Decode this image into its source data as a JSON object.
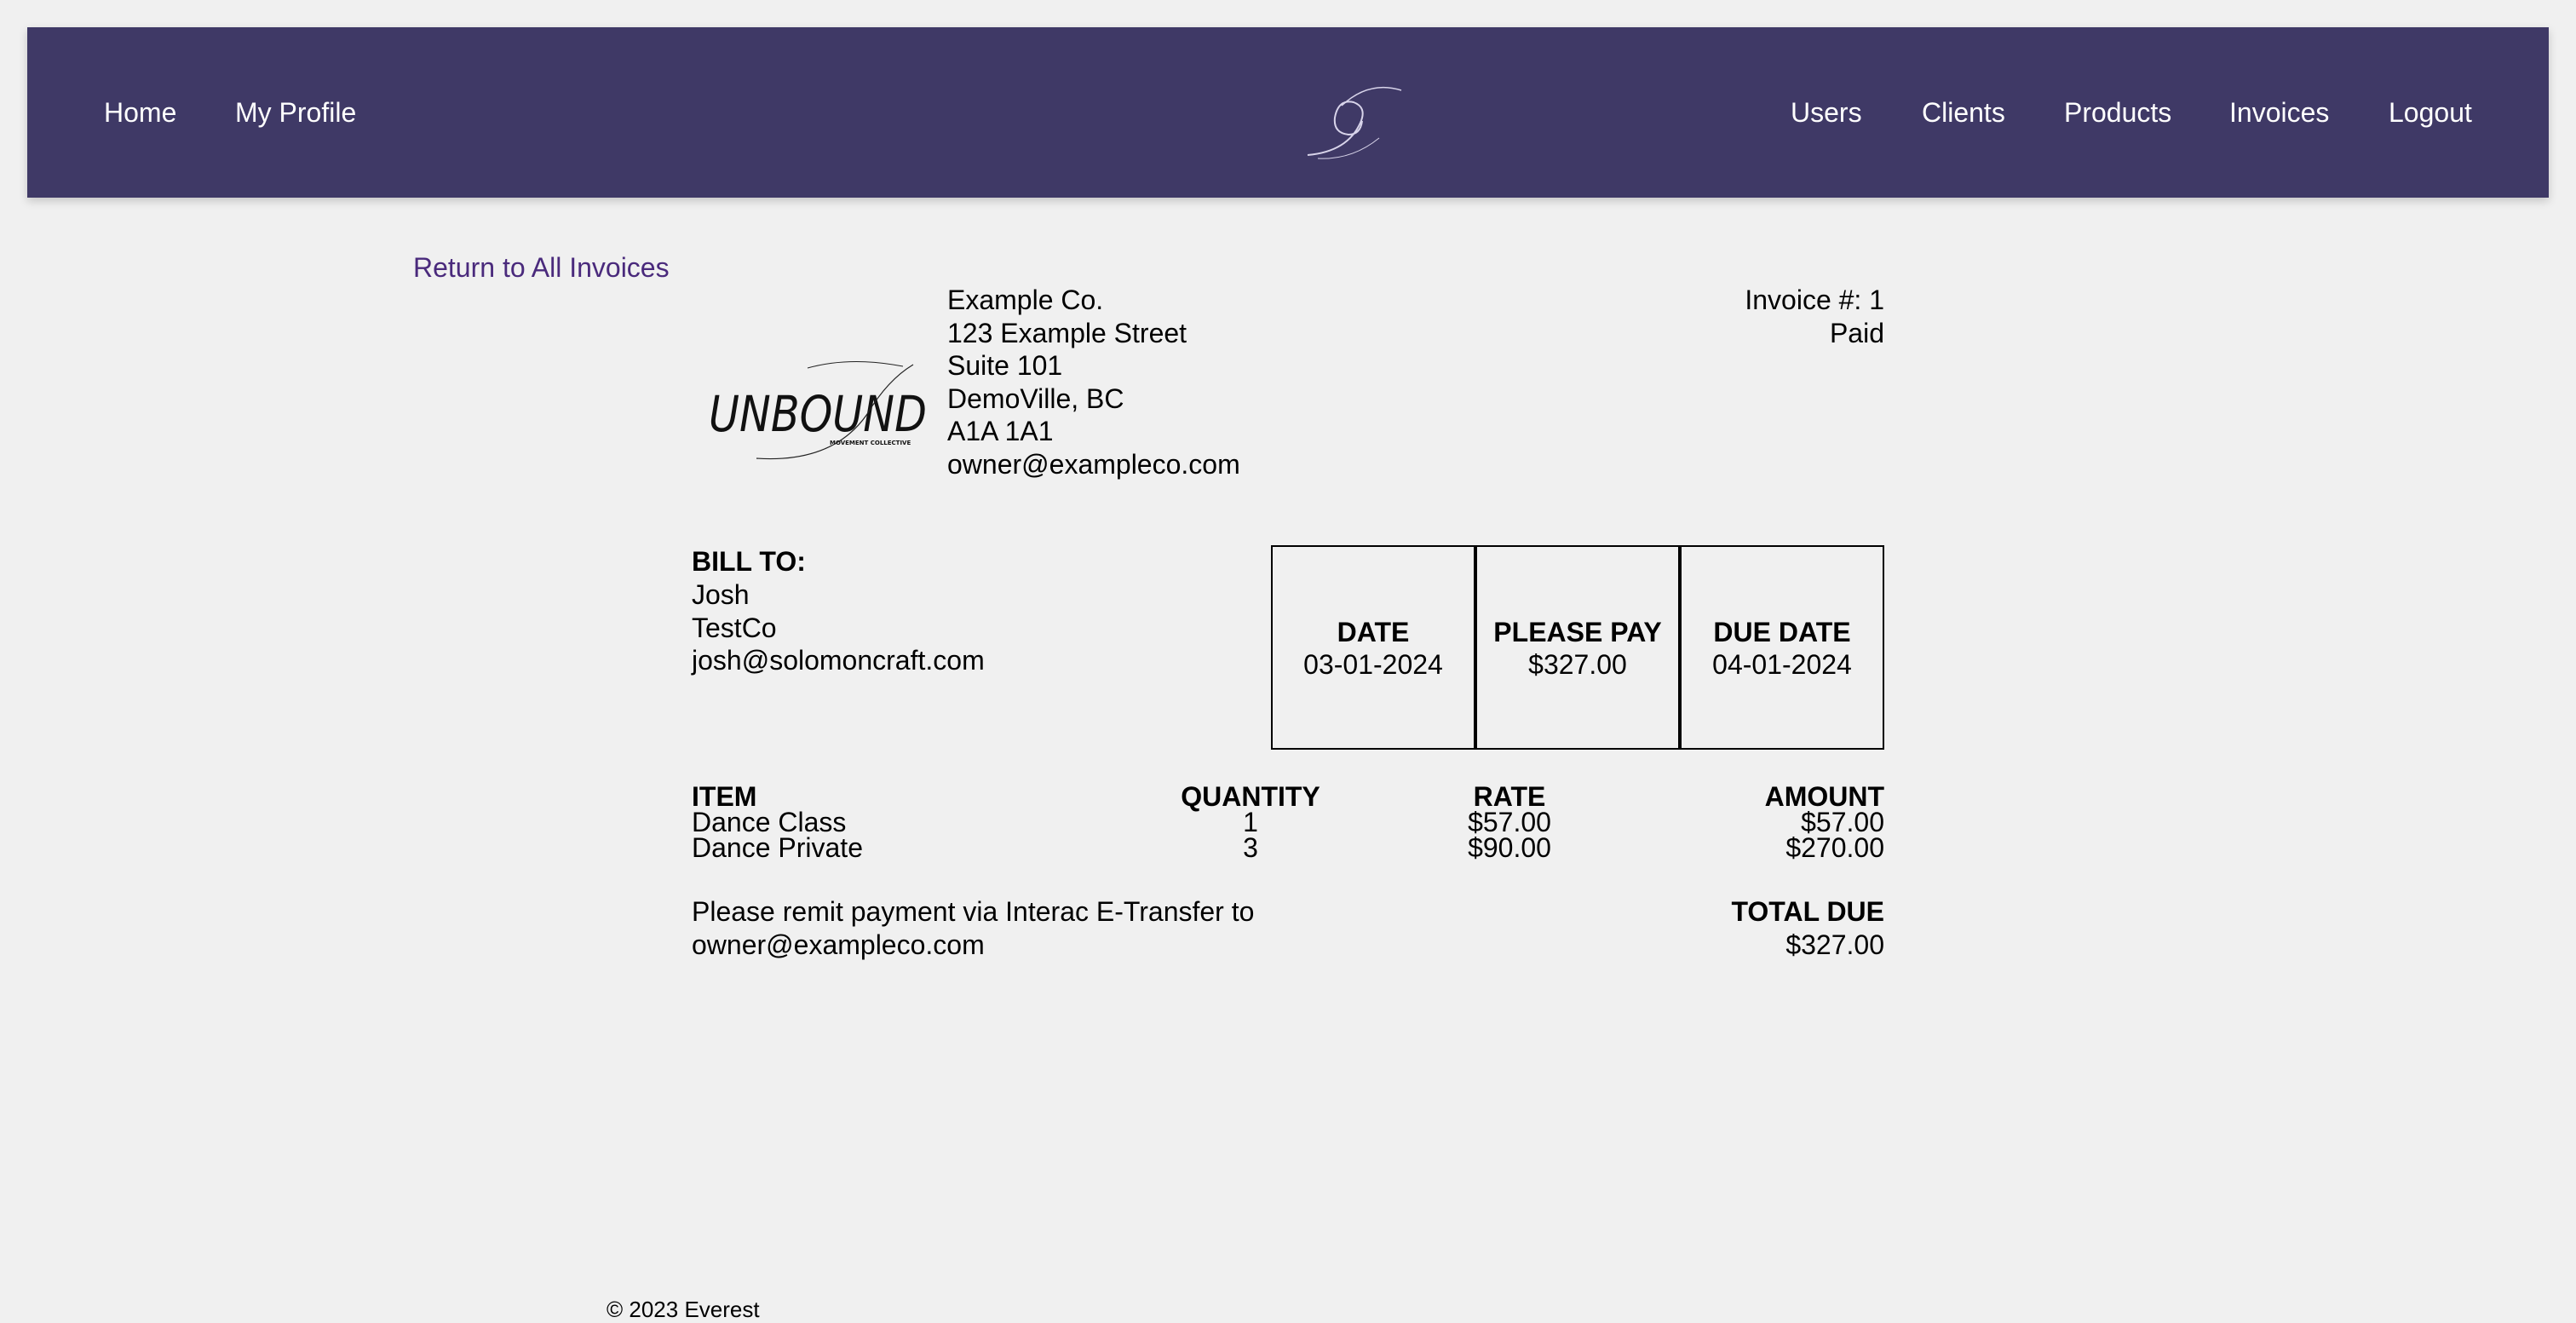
{
  "nav": {
    "home": "Home",
    "my_profile": "My Profile",
    "users": "Users",
    "clients": "Clients",
    "products": "Products",
    "invoices": "Invoices",
    "logout": "Logout"
  },
  "return_link": "Return to All Invoices",
  "company": {
    "logo_text": "UNBOUND",
    "logo_subtext": "MOVEMENT COLLECTIVE",
    "name": "Example Co.",
    "street": "123 Example Street",
    "suite": "Suite 101",
    "city": "DemoVille, BC",
    "postal": "A1A 1A1",
    "email": "owner@exampleco.com"
  },
  "invoice": {
    "number_label": "Invoice #: 1",
    "status": "Paid"
  },
  "bill_to": {
    "heading": "BILL TO:",
    "name": "Josh",
    "company": "TestCo",
    "email": "josh@solomoncraft.com"
  },
  "summary": {
    "date_label": "DATE",
    "date_value": "03-01-2024",
    "pay_label": "PLEASE PAY",
    "pay_value": "$327.00",
    "due_label": "DUE DATE",
    "due_value": "04-01-2024"
  },
  "items": {
    "headers": {
      "item": "ITEM",
      "quantity": "QUANTITY",
      "rate": "RATE",
      "amount": "AMOUNT"
    },
    "rows": [
      {
        "item": "Dance Class",
        "quantity": "1",
        "rate": "$57.00",
        "amount": "$57.00"
      },
      {
        "item": "Dance Private",
        "quantity": "3",
        "rate": "$90.00",
        "amount": "$270.00"
      }
    ]
  },
  "payment": {
    "line1": "Please remit payment via Interac E-Transfer to",
    "line2": "owner@exampleco.com"
  },
  "total": {
    "label": "TOTAL DUE",
    "value": "$327.00"
  },
  "footer": "© 2023 Everest",
  "colors": {
    "nav_bg": "#3f3966",
    "page_bg": "#f0f0f0",
    "link": "#4a2a7c"
  }
}
